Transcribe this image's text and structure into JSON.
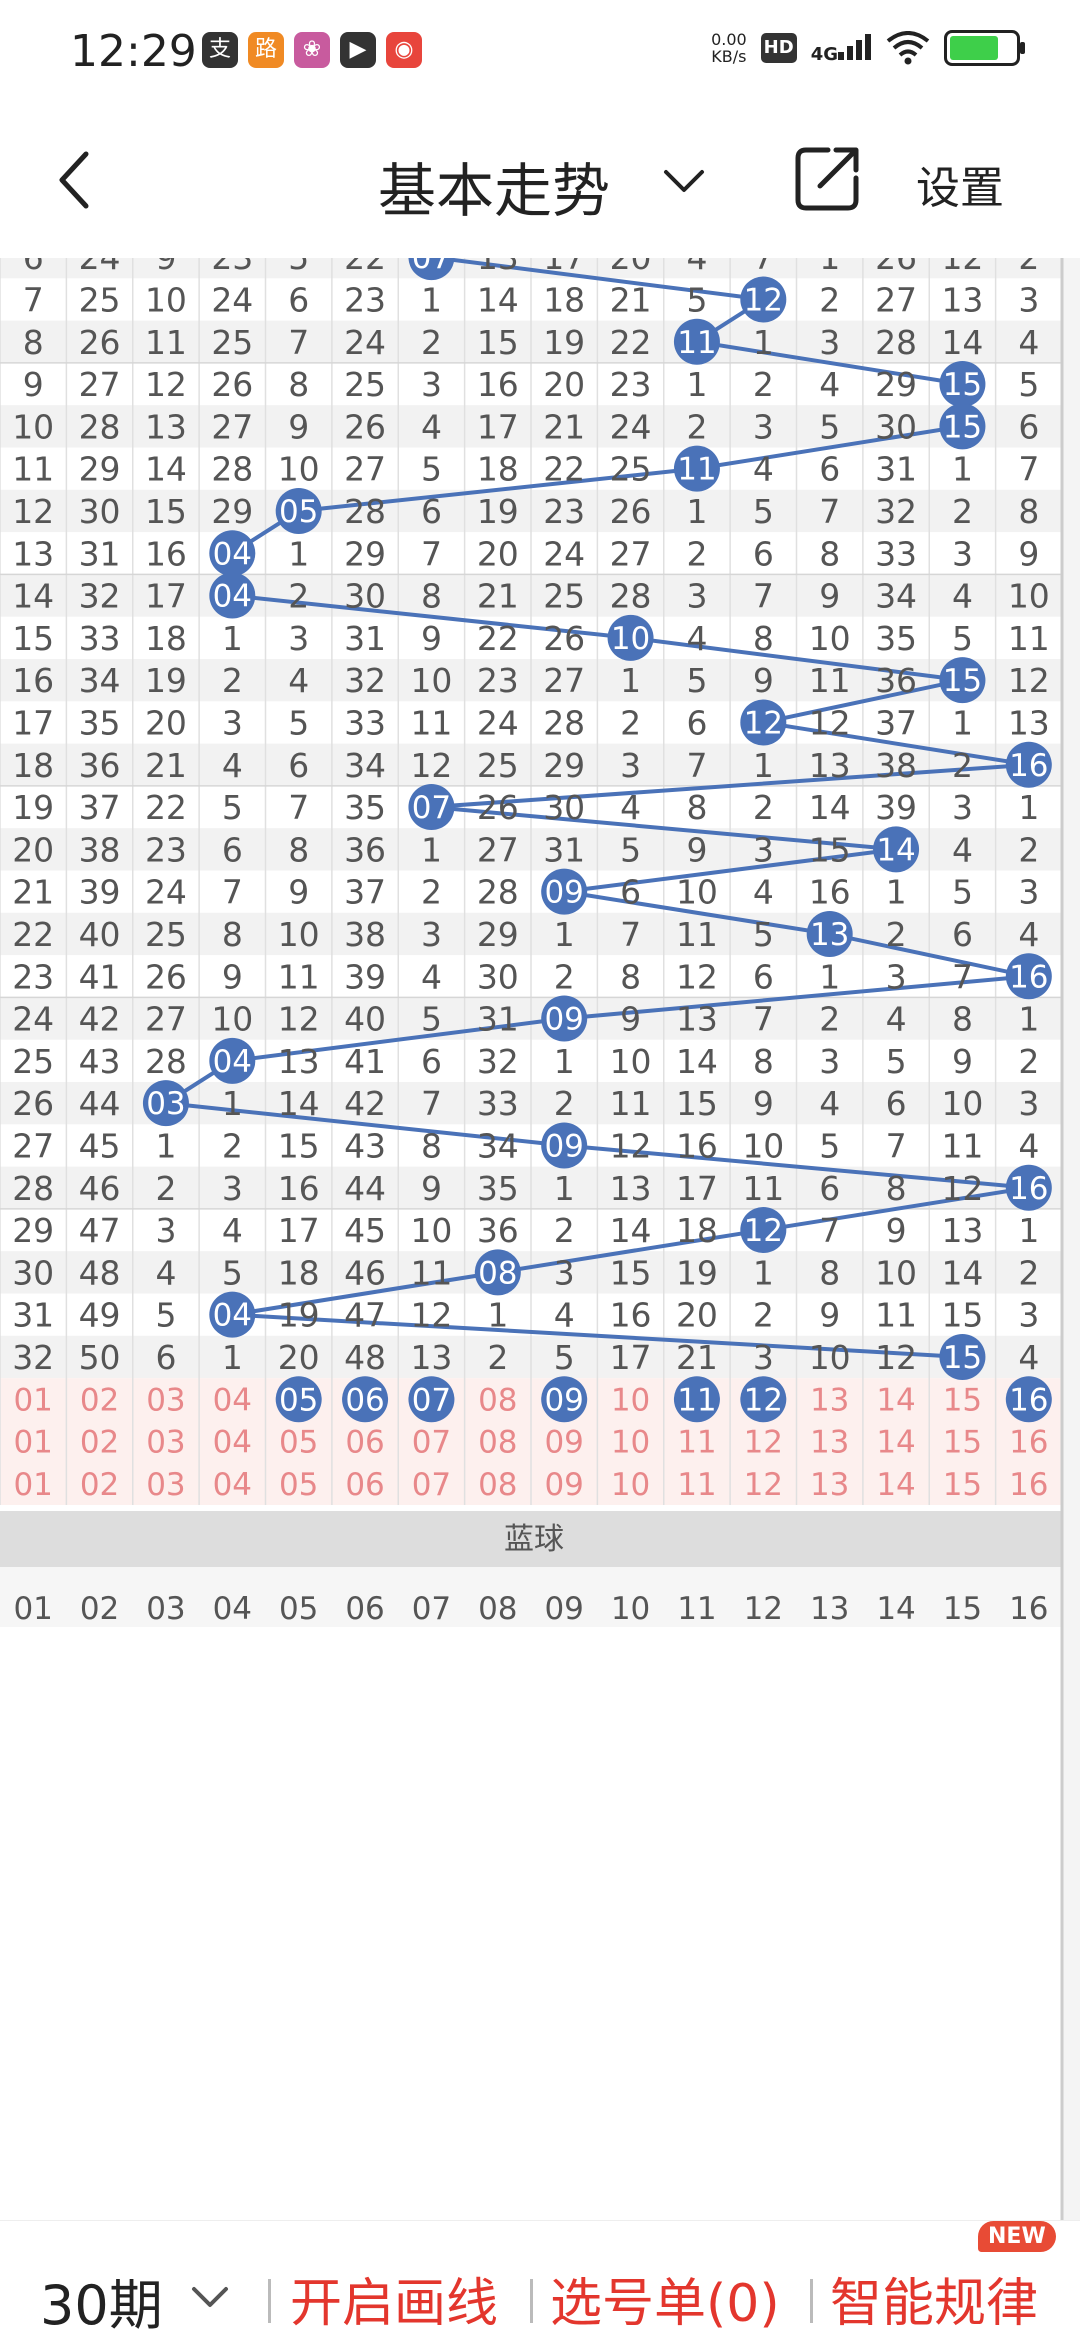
{
  "status_bar": {
    "time": "12:29",
    "apps": [
      {
        "icon": "alipay-icon",
        "glyph": "支",
        "color": "#333333"
      },
      {
        "icon": "game-app-icon",
        "glyph": "路",
        "color": "#f08a24"
      },
      {
        "icon": "photo-app-icon",
        "glyph": "❀",
        "color": "#c85b9e"
      },
      {
        "icon": "video-app-icon",
        "glyph": "▶",
        "color": "#333333"
      },
      {
        "icon": "tv-app-icon",
        "glyph": "◉",
        "color": "#e8453c"
      }
    ],
    "net_speed_value": "0.00",
    "net_speed_unit": "KB/s",
    "hd_label": "HD",
    "network_label": "4G",
    "battery_level": 0.75
  },
  "nav": {
    "title": "基本走势",
    "settings_label": "设置"
  },
  "chart_data": {
    "type": "table",
    "columns": 16,
    "first_row_partial": [
      6,
      24,
      9,
      23,
      5,
      22,
      7,
      13,
      17,
      20,
      4,
      7,
      1,
      26,
      12,
      2
    ],
    "rows": [
      [
        7,
        25,
        10,
        24,
        6,
        23,
        1,
        14,
        18,
        21,
        5,
        12,
        2,
        27,
        13,
        3
      ],
      [
        8,
        26,
        11,
        25,
        7,
        24,
        2,
        15,
        19,
        22,
        11,
        1,
        3,
        28,
        14,
        4
      ],
      [
        9,
        27,
        12,
        26,
        8,
        25,
        3,
        16,
        20,
        23,
        1,
        2,
        4,
        29,
        15,
        5
      ],
      [
        10,
        28,
        13,
        27,
        9,
        26,
        4,
        17,
        21,
        24,
        2,
        3,
        5,
        30,
        15,
        6
      ],
      [
        11,
        29,
        14,
        28,
        10,
        27,
        5,
        18,
        22,
        25,
        11,
        4,
        6,
        31,
        1,
        7
      ],
      [
        12,
        30,
        15,
        29,
        5,
        28,
        6,
        19,
        23,
        26,
        1,
        5,
        7,
        32,
        2,
        8
      ],
      [
        13,
        31,
        16,
        4,
        1,
        29,
        7,
        20,
        24,
        27,
        2,
        6,
        8,
        33,
        3,
        9
      ],
      [
        14,
        32,
        17,
        4,
        2,
        30,
        8,
        21,
        25,
        28,
        3,
        7,
        9,
        34,
        4,
        10
      ],
      [
        15,
        33,
        18,
        1,
        3,
        31,
        9,
        22,
        26,
        10,
        4,
        8,
        10,
        35,
        5,
        11
      ],
      [
        16,
        34,
        19,
        2,
        4,
        32,
        10,
        23,
        27,
        1,
        5,
        9,
        11,
        36,
        15,
        12
      ],
      [
        17,
        35,
        20,
        3,
        5,
        33,
        11,
        24,
        28,
        2,
        6,
        12,
        12,
        37,
        1,
        13
      ],
      [
        18,
        36,
        21,
        4,
        6,
        34,
        12,
        25,
        29,
        3,
        7,
        1,
        13,
        38,
        2,
        16
      ],
      [
        19,
        37,
        22,
        5,
        7,
        35,
        7,
        26,
        30,
        4,
        8,
        2,
        14,
        39,
        3,
        1
      ],
      [
        20,
        38,
        23,
        6,
        8,
        36,
        1,
        27,
        31,
        5,
        9,
        3,
        15,
        14,
        4,
        2
      ],
      [
        21,
        39,
        24,
        7,
        9,
        37,
        2,
        28,
        9,
        6,
        10,
        4,
        16,
        1,
        5,
        3
      ],
      [
        22,
        40,
        25,
        8,
        10,
        38,
        3,
        29,
        1,
        7,
        11,
        5,
        13,
        2,
        6,
        4
      ],
      [
        23,
        41,
        26,
        9,
        11,
        39,
        4,
        30,
        2,
        8,
        12,
        6,
        1,
        3,
        7,
        16
      ],
      [
        24,
        42,
        27,
        10,
        12,
        40,
        5,
        31,
        9,
        9,
        13,
        7,
        2,
        4,
        8,
        1
      ],
      [
        25,
        43,
        28,
        4,
        13,
        41,
        6,
        32,
        1,
        10,
        14,
        8,
        3,
        5,
        9,
        2
      ],
      [
        26,
        44,
        3,
        1,
        14,
        42,
        7,
        33,
        2,
        11,
        15,
        9,
        4,
        6,
        10,
        3
      ],
      [
        27,
        45,
        1,
        2,
        15,
        43,
        8,
        34,
        9,
        12,
        16,
        10,
        5,
        7,
        11,
        4
      ],
      [
        28,
        46,
        2,
        3,
        16,
        44,
        9,
        35,
        1,
        13,
        17,
        11,
        6,
        8,
        12,
        16
      ],
      [
        29,
        47,
        3,
        4,
        17,
        45,
        10,
        36,
        2,
        14,
        18,
        12,
        7,
        9,
        13,
        1
      ],
      [
        30,
        48,
        4,
        5,
        18,
        46,
        11,
        8,
        3,
        15,
        19,
        1,
        8,
        10,
        14,
        2
      ],
      [
        31,
        49,
        5,
        4,
        19,
        47,
        12,
        1,
        4,
        16,
        20,
        2,
        9,
        11,
        15,
        3
      ],
      [
        32,
        50,
        6,
        1,
        20,
        48,
        13,
        2,
        5,
        17,
        21,
        3,
        10,
        12,
        15,
        4
      ]
    ],
    "hit_column_index_by_row": [
      11,
      10,
      14,
      14,
      10,
      4,
      3,
      3,
      9,
      14,
      11,
      15,
      6,
      13,
      8,
      12,
      15,
      8,
      3,
      2,
      8,
      15,
      11,
      7,
      3,
      14
    ],
    "first_row_hit_column_index": 6,
    "stat_rows": [
      [
        "01",
        "02",
        "03",
        "04",
        "05",
        "06",
        "07",
        "08",
        "09",
        "10",
        "11",
        "12",
        "13",
        "14",
        "15",
        "16"
      ],
      [
        "01",
        "02",
        "03",
        "04",
        "05",
        "06",
        "07",
        "08",
        "09",
        "10",
        "11",
        "12",
        "13",
        "14",
        "15",
        "16"
      ],
      [
        "01",
        "02",
        "03",
        "04",
        "05",
        "06",
        "07",
        "08",
        "09",
        "10",
        "11",
        "12",
        "13",
        "14",
        "15",
        "16"
      ]
    ],
    "stat_row_highlights": [
      4,
      5,
      6,
      8,
      10,
      11,
      15
    ],
    "section_label": "蓝球",
    "bottom_partial_row": [
      "01",
      "02",
      "03",
      "04",
      "05",
      "06",
      "07",
      "08",
      "09",
      "10",
      "11",
      "12",
      "13",
      "14",
      "15",
      "16"
    ],
    "colors": {
      "ball": "#4a72b8",
      "line": "#4a72b8",
      "text": "#555555",
      "stat_text": "#e8888a",
      "stat_bg": "#fdf0ee",
      "band_bg": "#f2f2f2",
      "section_bg": "#dddddd"
    }
  },
  "bottom_bar": {
    "periods_label": "30期",
    "draw_line_label": "开启画线",
    "number_list_label": "选号单(0)",
    "smart_rule_label": "智能规律",
    "new_badge": "NEW"
  }
}
